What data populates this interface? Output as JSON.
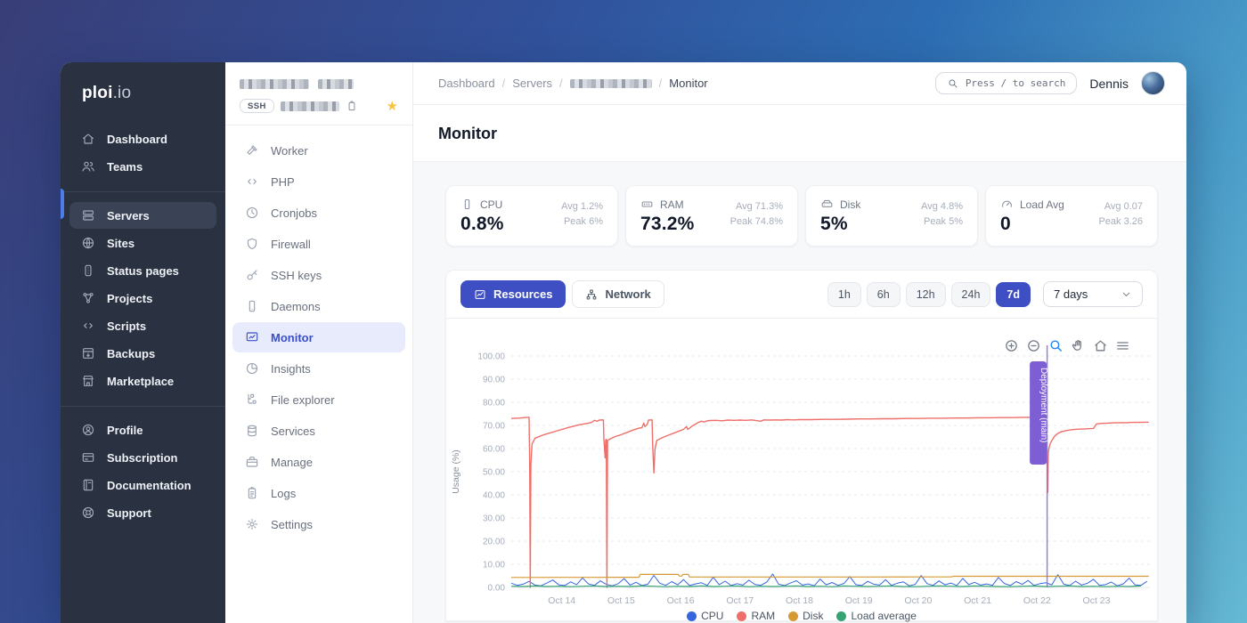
{
  "brand": {
    "bold": "ploi",
    "light": ".io"
  },
  "sidebar": {
    "sections": [
      {
        "items": [
          {
            "label": "Dashboard",
            "icon": "home"
          },
          {
            "label": "Teams",
            "icon": "users"
          }
        ]
      },
      {
        "items": [
          {
            "label": "Servers",
            "icon": "server",
            "active": true
          },
          {
            "label": "Sites",
            "icon": "globe"
          },
          {
            "label": "Status pages",
            "icon": "status"
          },
          {
            "label": "Projects",
            "icon": "nodes"
          },
          {
            "label": "Scripts",
            "icon": "code"
          },
          {
            "label": "Backups",
            "icon": "backup"
          },
          {
            "label": "Marketplace",
            "icon": "store"
          }
        ]
      },
      {
        "items": [
          {
            "label": "Profile",
            "icon": "user-circle"
          },
          {
            "label": "Subscription",
            "icon": "credit-card"
          },
          {
            "label": "Documentation",
            "icon": "book"
          },
          {
            "label": "Support",
            "icon": "lifebuoy"
          }
        ]
      }
    ]
  },
  "server_sidebar": {
    "ssh_badge": "SSH",
    "items": [
      {
        "label": "Worker",
        "icon": "hammer"
      },
      {
        "label": "PHP",
        "icon": "code"
      },
      {
        "label": "Cronjobs",
        "icon": "clock"
      },
      {
        "label": "Firewall",
        "icon": "shield"
      },
      {
        "label": "SSH keys",
        "icon": "key"
      },
      {
        "label": "Daemons",
        "icon": "phone"
      },
      {
        "label": "Monitor",
        "icon": "monitor",
        "active": true
      },
      {
        "label": "Insights",
        "icon": "pie"
      },
      {
        "label": "File explorer",
        "icon": "tree"
      },
      {
        "label": "Services",
        "icon": "database"
      },
      {
        "label": "Manage",
        "icon": "briefcase"
      },
      {
        "label": "Logs",
        "icon": "clipboard"
      },
      {
        "label": "Settings",
        "icon": "gear"
      }
    ]
  },
  "header": {
    "separator": "/",
    "breadcrumb": [
      {
        "type": "link",
        "label": "Dashboard"
      },
      {
        "type": "link",
        "label": "Servers"
      },
      {
        "type": "redacted"
      },
      {
        "type": "current",
        "label": "Monitor"
      }
    ]
  },
  "search": {
    "placeholder": "Press / to search"
  },
  "user": {
    "name": "Dennis"
  },
  "page": {
    "title": "Monitor"
  },
  "stats": [
    {
      "icon": "cpu",
      "label": "CPU",
      "value": "0.8%",
      "avg": "Avg 1.2%",
      "peak": "Peak 6%"
    },
    {
      "icon": "ram",
      "label": "RAM",
      "value": "73.2%",
      "avg": "Avg 71.3%",
      "peak": "Peak 74.8%"
    },
    {
      "icon": "disk",
      "label": "Disk",
      "value": "5%",
      "avg": "Avg 4.8%",
      "peak": "Peak 5%"
    },
    {
      "icon": "gauge",
      "label": "Load Avg",
      "value": "0",
      "avg": "Avg 0.07",
      "peak": "Peak 3.26"
    }
  ],
  "tabs": [
    {
      "label": "Resources",
      "icon": "chart",
      "active": true
    },
    {
      "label": "Network",
      "icon": "network",
      "active": false
    }
  ],
  "ranges": [
    {
      "label": "1h"
    },
    {
      "label": "6h"
    },
    {
      "label": "12h"
    },
    {
      "label": "24h"
    },
    {
      "label": "7d",
      "active": true
    }
  ],
  "range_select": {
    "value": "7 days"
  },
  "chart_data": {
    "type": "line",
    "ylabel": "Usage (%)",
    "ylim": [
      0,
      100
    ],
    "grid": "dashed-horizontal",
    "legend_position": "bottom",
    "y_ticks": [
      "0.00",
      "10.00",
      "20.00",
      "30.00",
      "40.00",
      "50.00",
      "60.00",
      "70.00",
      "80.00",
      "90.00",
      "100.00"
    ],
    "x_range": [
      13.15,
      23.9
    ],
    "x_ticks": [
      {
        "day": 14,
        "label": "Oct 14"
      },
      {
        "day": 15,
        "label": "Oct 15"
      },
      {
        "day": 16,
        "label": "Oct 16"
      },
      {
        "day": 17,
        "label": "Oct 17"
      },
      {
        "day": 18,
        "label": "Oct 18"
      },
      {
        "day": 19,
        "label": "Oct 19"
      },
      {
        "day": 20,
        "label": "Oct 20"
      },
      {
        "day": 21,
        "label": "Oct 21"
      },
      {
        "day": 22,
        "label": "Oct 22"
      },
      {
        "day": 23,
        "label": "Oct 23"
      }
    ],
    "toolbar": [
      "zoom-in",
      "zoom-out",
      "selection-zoom",
      "pan",
      "home",
      "menu"
    ],
    "annotation": {
      "type": "vline",
      "x": 22.17,
      "label": "Deployment (main)",
      "color": "#8b72d9"
    },
    "series": [
      {
        "name": "CPU",
        "color": "#3566df",
        "width": 1,
        "start": 13.15,
        "step": 0.1,
        "values": [
          1.8,
          0.9,
          1.4,
          2.6,
          1.0,
          0.7,
          1.9,
          3.2,
          1.1,
          0.8,
          2.4,
          1.2,
          4.1,
          1.5,
          0.9,
          2.8,
          1.3,
          0.7,
          1.6,
          3.8,
          1.0,
          2.2,
          0.8,
          1.4,
          5.2,
          1.8,
          0.9,
          2.5,
          1.1,
          3.4,
          0.8,
          1.5,
          2.0,
          0.9,
          4.4,
          1.2,
          2.7,
          0.8,
          1.6,
          1.0,
          3.1,
          1.3,
          0.9,
          2.3,
          5.8,
          1.4,
          0.8,
          1.9,
          2.9,
          1.0,
          1.5,
          0.7,
          3.6,
          1.1,
          2.1,
          0.9,
          1.7,
          4.7,
          1.2,
          0.8,
          2.6,
          1.4,
          1.0,
          3.3,
          0.9,
          1.8,
          2.4,
          0.7,
          1.3,
          5.1,
          1.6,
          0.9,
          2.8,
          1.1,
          1.9,
          0.8,
          3.9,
          1.2,
          2.2,
          1.0,
          1.5,
          0.9,
          4.3,
          1.7,
          0.8,
          2.5,
          1.3,
          3.0,
          0.9,
          1.6,
          2.0,
          1.1,
          5.5,
          1.4,
          0.8,
          2.7,
          1.0,
          1.8,
          3.5,
          0.9,
          1.2,
          2.3,
          0.7,
          1.5,
          4.0,
          1.1,
          0.9,
          2.6
        ]
      },
      {
        "name": "RAM",
        "color": "#ee6f6a",
        "width": 1.4,
        "points": [
          [
            13.15,
            73
          ],
          [
            13.3,
            73.2
          ],
          [
            13.42,
            73.5
          ],
          [
            13.45,
            73.5
          ],
          [
            13.46,
            53
          ],
          [
            13.47,
            0
          ],
          [
            13.48,
            53
          ],
          [
            13.5,
            62
          ],
          [
            13.55,
            64.5
          ],
          [
            13.7,
            66
          ],
          [
            13.9,
            67.5
          ],
          [
            14.1,
            69
          ],
          [
            14.3,
            70.3
          ],
          [
            14.45,
            71
          ],
          [
            14.5,
            71.3
          ],
          [
            14.55,
            72.2
          ],
          [
            14.6,
            71.8
          ],
          [
            14.63,
            72.3
          ],
          [
            14.7,
            72.4
          ],
          [
            14.71,
            64
          ],
          [
            14.73,
            56
          ],
          [
            14.74,
            63.5
          ],
          [
            14.75,
            64
          ],
          [
            14.76,
            0
          ],
          [
            14.77,
            63.5
          ],
          [
            14.8,
            64
          ],
          [
            14.9,
            65.2
          ],
          [
            15.0,
            66
          ],
          [
            15.1,
            67
          ],
          [
            15.2,
            68
          ],
          [
            15.3,
            68.8
          ],
          [
            15.35,
            69
          ],
          [
            15.38,
            71
          ],
          [
            15.4,
            69.5
          ],
          [
            15.44,
            70.5
          ],
          [
            15.46,
            72.3
          ],
          [
            15.52,
            72.4
          ],
          [
            15.53,
            62
          ],
          [
            15.55,
            49.5
          ],
          [
            15.57,
            60
          ],
          [
            15.6,
            63.5
          ],
          [
            15.7,
            64.8
          ],
          [
            15.8,
            65.8
          ],
          [
            15.9,
            66.8
          ],
          [
            16.0,
            67.8
          ],
          [
            16.05,
            68.3
          ],
          [
            16.1,
            69.5
          ],
          [
            16.12,
            68.3
          ],
          [
            16.15,
            68.8
          ],
          [
            16.2,
            69.8
          ],
          [
            16.3,
            71.3
          ],
          [
            16.35,
            71.8
          ],
          [
            16.4,
            71.5
          ],
          [
            16.45,
            72
          ],
          [
            16.5,
            72.1
          ],
          [
            16.6,
            72.2
          ],
          [
            16.7,
            72
          ],
          [
            16.8,
            72.3
          ],
          [
            16.9,
            72.2
          ],
          [
            17.0,
            72.3
          ],
          [
            17.1,
            72.2
          ],
          [
            17.2,
            72.4
          ],
          [
            17.35,
            71.8
          ],
          [
            17.4,
            72.4
          ],
          [
            17.5,
            72.3
          ],
          [
            17.6,
            72.4
          ],
          [
            17.7,
            72.3
          ],
          [
            17.8,
            72.5
          ],
          [
            17.9,
            72.4
          ],
          [
            18.0,
            72.5
          ],
          [
            18.2,
            72.5
          ],
          [
            18.4,
            72.6
          ],
          [
            18.6,
            72.6
          ],
          [
            18.8,
            72.7
          ],
          [
            19.0,
            72.8
          ],
          [
            19.2,
            72.8
          ],
          [
            19.4,
            72.9
          ],
          [
            19.6,
            72.9
          ],
          [
            19.8,
            73
          ],
          [
            20.0,
            73
          ],
          [
            20.2,
            73.1
          ],
          [
            20.4,
            73.1
          ],
          [
            20.6,
            73.2
          ],
          [
            20.8,
            73.2
          ],
          [
            21.0,
            73.3
          ],
          [
            21.2,
            73.3
          ],
          [
            21.4,
            73.4
          ],
          [
            21.6,
            73.4
          ],
          [
            21.8,
            73.5
          ],
          [
            22.0,
            73.5
          ],
          [
            22.15,
            73.5
          ],
          [
            22.16,
            60
          ],
          [
            22.17,
            54
          ],
          [
            22.18,
            41
          ],
          [
            22.19,
            58
          ],
          [
            22.2,
            60
          ],
          [
            22.22,
            62
          ],
          [
            22.25,
            63.5
          ],
          [
            22.3,
            65.5
          ],
          [
            22.35,
            66.5
          ],
          [
            22.4,
            67.2
          ],
          [
            22.5,
            67.8
          ],
          [
            22.6,
            68.2
          ],
          [
            22.7,
            68.4
          ],
          [
            22.8,
            68.5
          ],
          [
            22.9,
            68.6
          ],
          [
            22.95,
            68.7
          ],
          [
            23.0,
            70.6
          ],
          [
            23.05,
            70.8
          ],
          [
            23.1,
            70.9
          ],
          [
            23.2,
            71
          ],
          [
            23.3,
            71.1
          ],
          [
            23.4,
            71.2
          ],
          [
            23.5,
            71.2
          ],
          [
            23.6,
            71.3
          ],
          [
            23.7,
            71.3
          ],
          [
            23.8,
            71.4
          ],
          [
            23.88,
            71.4
          ]
        ]
      },
      {
        "name": "Disk",
        "color": "#d69a35",
        "width": 1.2,
        "points": [
          [
            13.15,
            4.3
          ],
          [
            13.5,
            4.3
          ],
          [
            14.0,
            4.35
          ],
          [
            14.5,
            4.35
          ],
          [
            15.0,
            4.4
          ],
          [
            15.3,
            4.4
          ],
          [
            15.32,
            5.6
          ],
          [
            15.96,
            5.6
          ],
          [
            15.98,
            4.9
          ],
          [
            16.02,
            4.9
          ],
          [
            16.04,
            5.6
          ],
          [
            16.13,
            5.6
          ],
          [
            16.15,
            4.5
          ],
          [
            17.0,
            4.5
          ],
          [
            18.0,
            4.5
          ],
          [
            19.0,
            4.5
          ],
          [
            20.0,
            4.55
          ],
          [
            20.55,
            4.55
          ],
          [
            20.6,
            4.8
          ],
          [
            21.0,
            4.8
          ],
          [
            22.0,
            4.8
          ],
          [
            23.0,
            4.8
          ],
          [
            23.88,
            4.8
          ]
        ]
      },
      {
        "name": "Load average",
        "color": "#35a372",
        "width": 1.2,
        "start": 13.15,
        "step": 0.2,
        "values": [
          0.5,
          0.4,
          0.6,
          0.4,
          0.5,
          0.3,
          0.5,
          0.6,
          0.4,
          0.5,
          0.4,
          0.6,
          0.5,
          0.3,
          0.5,
          0.4,
          0.6,
          0.4,
          0.5,
          0.6,
          0.3,
          0.5,
          0.4,
          0.5,
          0.6,
          0.4,
          0.5,
          0.3,
          0.6,
          0.5,
          0.4,
          0.5,
          0.6,
          0.4,
          0.3,
          0.5,
          0.6,
          0.5,
          0.4,
          0.6,
          0.5,
          0.4,
          0.3,
          0.5,
          0.6,
          0.4,
          0.5,
          0.6,
          0.4,
          0.5,
          0.3,
          0.5,
          0.4,
          0.6
        ]
      }
    ]
  }
}
